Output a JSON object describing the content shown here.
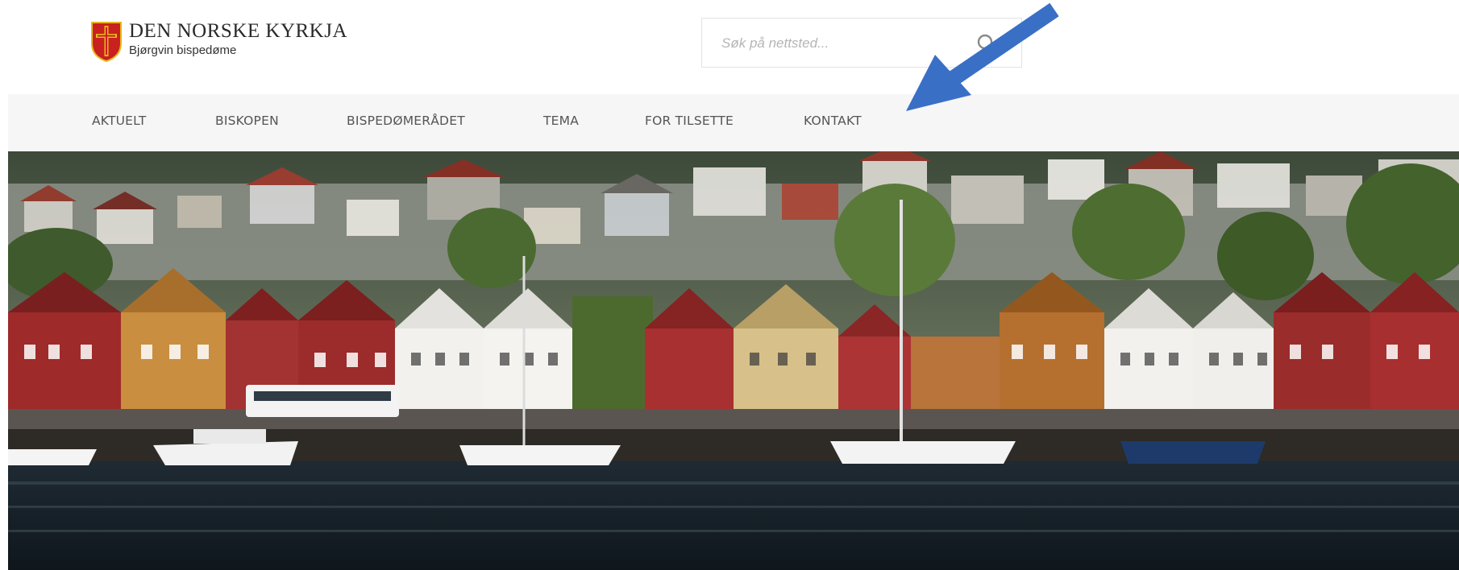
{
  "brand": {
    "title": "DEN NORSKE KYRKJA",
    "subtitle": "Bjørgvin bispedøme"
  },
  "search": {
    "placeholder": "Søk på nettsted...",
    "icon": "search-icon"
  },
  "nav": {
    "items": [
      {
        "label": "AKTUELT"
      },
      {
        "label": "BISKOPEN"
      },
      {
        "label": "BISPEDØMERÅDET"
      },
      {
        "label": "TEMA"
      },
      {
        "label": "FOR TILSETTE"
      },
      {
        "label": "KONTAKT"
      }
    ]
  },
  "colors": {
    "arrow": "#3a6fc6",
    "nav_bg": "#f6f6f6",
    "nav_text": "#555555",
    "crest_red": "#c8211f",
    "crest_gold": "#e8b81a"
  }
}
